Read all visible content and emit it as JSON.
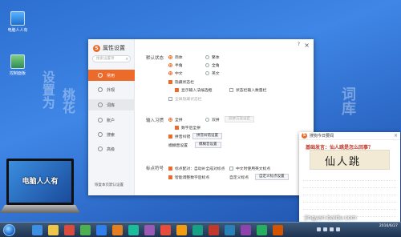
{
  "desktop": {
    "icons": [
      {
        "label": "电脑人人有"
      },
      {
        "label": "控制面板"
      }
    ],
    "wallpaper_text": [
      "设置为",
      "桃花",
      "词库"
    ]
  },
  "window": {
    "title": "属性设置",
    "search_placeholder": "搜索设置项",
    "help": "?",
    "close": "×",
    "nav": [
      {
        "label": "常用",
        "active": true
      },
      {
        "label": "外观"
      },
      {
        "label": "词库"
      },
      {
        "label": "账户"
      },
      {
        "label": "搜索"
      },
      {
        "label": "高级"
      }
    ],
    "restore_defaults": "恢复本页默认设置",
    "sections": {
      "default_state": {
        "label": "默认状态",
        "rows": [
          [
            {
              "text": "简体",
              "on": true
            },
            {
              "text": "繁体",
              "on": false
            }
          ],
          [
            {
              "text": "半角",
              "on": true
            },
            {
              "text": "全角",
              "on": false
            }
          ],
          [
            {
              "text": "中文",
              "on": true
            },
            {
              "text": "英文",
              "on": false
            }
          ]
        ],
        "hide_status_bar": "隐藏状态栏",
        "show_candidate": "显示输入法候选框",
        "status_bar_note": "状态栏输入数量栏",
        "auto_adjust": "全屏隐藏状态栏"
      },
      "input_habit": {
        "label": "输入习惯",
        "shift_label": "全拼",
        "shuangpin_label": "双拼",
        "shuangpin_scheme_button": "双拼方案设定",
        "quick_input": "数字后全拼",
        "fuzzy_label": "拼音纠错",
        "fuzzy_button": "拼音纠错设置",
        "fuzzy2_label": "模糊音设置",
        "fuzzy2_button": "模糊音设置"
      },
      "punctuation": {
        "label": "标点符号",
        "auto_pair": "标点配对：自动补全成对标点",
        "chinese_english": "中文时使用英文标点",
        "smart_punct": "智能调整数字后标点",
        "custom_label": "自定义标点",
        "custom_button": "自定义标点设置"
      }
    }
  },
  "news": {
    "header": "搜狗今日要闻",
    "close": "×",
    "headline": "基础发言：仙人跳是怎么回事？",
    "image_text": "仙人跳"
  },
  "laptop": {
    "screen_text": "电脑人人有"
  },
  "taskbar": {
    "watermark": "jingyan.baidu.com",
    "time": "",
    "date": "2016/6/27"
  }
}
